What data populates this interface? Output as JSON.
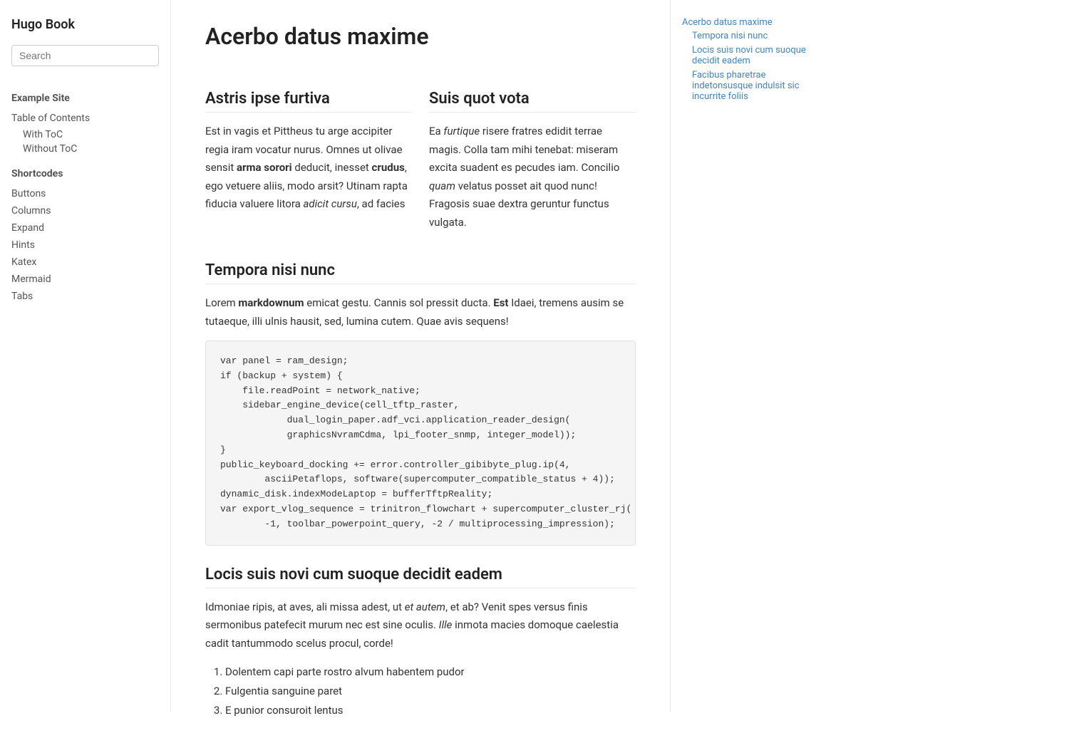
{
  "site": {
    "title": "Hugo Book"
  },
  "search": {
    "placeholder": "Search"
  },
  "sidebar": {
    "example_site_label": "Example Site",
    "toc_label": "Table of Contents",
    "toc_with": "With ToC",
    "toc_without": "Without ToC",
    "shortcodes_label": "Shortcodes",
    "shortcodes_items": [
      {
        "label": "Buttons"
      },
      {
        "label": "Columns"
      },
      {
        "label": "Expand"
      },
      {
        "label": "Hints"
      },
      {
        "label": "Katex"
      },
      {
        "label": "Mermaid"
      },
      {
        "label": "Tabs"
      }
    ]
  },
  "main": {
    "page_title": "Acerbo datus maxime",
    "sections": [
      {
        "heading": "Astris ipse furtiva",
        "paragraphs": [
          "Est in vagis et Pittheus tu arge accipiter regia iram vocatur nurus. Omnes ut olivae sensit arma sorori deducit, inesset crudus, ego vetuere aliis, modo arsit? Utinam rapta fiducia valuere litora adicit cursu, ad facies"
        ]
      },
      {
        "heading": "Suis quot vota",
        "paragraphs": [
          "Ea furtique risere fratres edidit terrae magis. Colla tam mihi tenebat: miseram excita suadent es pecudes iam. Concilio quam velatus posset ait quod nunc! Fragosis suae dextra geruntur functus vulgata."
        ]
      }
    ],
    "section2_heading": "Tempora nisi nunc",
    "section2_para": "Lorem markdownum emicat gestu. Cannis sol pressit ducta. Est Idaei, tremens ausim se tutaeque, illi ulnis hausit, sed, lumina cutem. Quae avis sequens!",
    "code_block": "var panel = ram_design;\nif (backup + system) {\n    file.readPoint = network_native;\n    sidebar_engine_device(cell_tftp_raster,\n            dual_login_paper.adf_vci.application_reader_design(\n            graphicsNvramCdma, lpi_footer_snmp, integer_model));\n}\npublic_keyboard_docking += error.controller_gibibyte_plug.ip(4,\n        asciiPetaflops, software(supercomputer_compatible_status + 4));\ndynamic_disk.indexModeLaptop = bufferTftpReality;\nvar export_vlog_sequence = trinitron_flowchart + supercomputer_cluster_rj(\n        -1, toolbar_powerpoint_query, -2 / multiprocessing_impression);",
    "section3_heading": "Locis suis novi cum suoque decidit eadem",
    "section3_para1_before": "Idmoniae ripis, at aves, ali missa adest, ut ",
    "section3_para1_italic": "et autem",
    "section3_para1_after": ", et ab? Venit spes versus finis sermonibus patefecit murum nec est sine oculis. ",
    "section3_para1_italic2": "Ille",
    "section3_para1_rest": " inmota macies domoque caelestia cadit tantummodo scelus procul, corde!",
    "section3_list": [
      "Dolentem capi parte rostro alvum habentem pudor",
      "Fulgentia sanguine paret",
      "E punior consuroit lentus"
    ]
  },
  "toc": {
    "items": [
      {
        "label": "Acerbo datus maxime",
        "sub": [
          {
            "label": "Tempora nisi nunc"
          },
          {
            "label": "Locis suis novi cum suoque decidit eadem"
          },
          {
            "label": "Facibus pharetrae indetonsusque indulsit sic incurrite foliis"
          }
        ]
      }
    ]
  }
}
